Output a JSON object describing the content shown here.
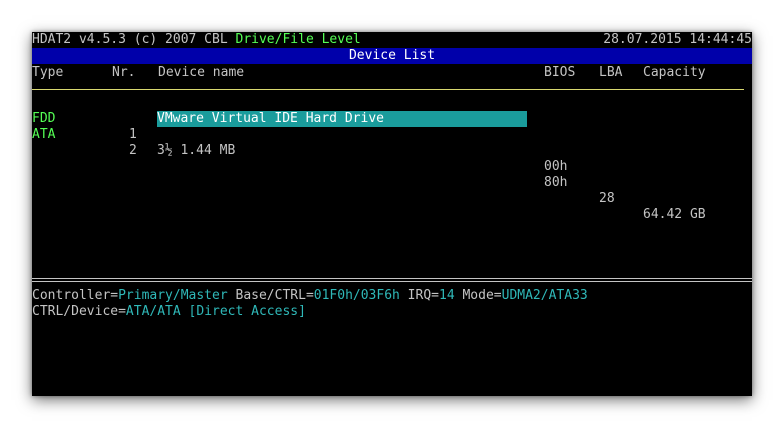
{
  "titlebar": {
    "app": "HDAT2 v4.5.3 (c) 2007 CBL",
    "mode": "Drive/File Level",
    "datetime": "28.07.2015 14:44:45"
  },
  "header": {
    "title": "Device List"
  },
  "columns": {
    "type": "Type",
    "nr": "Nr.",
    "device_name": "Device name",
    "bios": "BIOS",
    "lba": "LBA",
    "capacity": "Capacity"
  },
  "devices": [
    {
      "type": "FDD",
      "nr": "1",
      "name": "3½ 1.44 MB",
      "bios": "00h",
      "lba": "",
      "capacity": ""
    },
    {
      "type": "ATA",
      "nr": "2",
      "name": "VMware Virtual IDE Hard Drive",
      "bios": "80h",
      "lba": "28",
      "capacity": "64.42 GB"
    }
  ],
  "details": {
    "controller_label": "Controller=",
    "controller_value": "Primary/Master",
    "base_label": " Base/CTRL=",
    "base_value": "01F0h/03F6h",
    "irq_label": " IRQ=",
    "irq_value": "14",
    "mode_label": " Mode=",
    "mode_value": "UDMA2/ATA33",
    "ctrl_label": "CTRL/Device=",
    "ctrl_value": "ATA/ATA [Direct Access]"
  },
  "colors": {
    "screen_bg": "#000000",
    "header_bg": "#0000aa",
    "highlight_bg": "#1a9c9c",
    "green": "#55ff55",
    "cyan": "#2fb8b8"
  }
}
